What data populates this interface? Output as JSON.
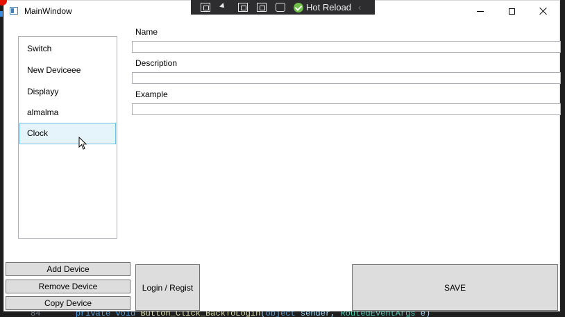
{
  "window": {
    "title": "MainWindow",
    "icon": "window-app-icon"
  },
  "caption_buttons": {
    "minimize": "minimize-icon",
    "maximize": "maximize-icon",
    "close": "close-icon"
  },
  "debug_toolbar": {
    "hot_reload_label": "Hot Reload",
    "icons": [
      "select-element-icon",
      "pointer-icon",
      "layout-adorner-icon",
      "track-focus-icon",
      "hot-reload-settings-icon"
    ]
  },
  "device_list": {
    "items": [
      {
        "label": "Switch",
        "selected": false
      },
      {
        "label": "New Deviceee",
        "selected": false
      },
      {
        "label": "Displayy",
        "selected": false
      },
      {
        "label": "almalma",
        "selected": false
      },
      {
        "label": "Clock",
        "selected": true
      }
    ]
  },
  "form": {
    "name_label": "Name",
    "name_value": "",
    "description_label": "Description",
    "description_value": "",
    "example_label": "Example",
    "example_value": ""
  },
  "buttons": {
    "add_device": "Add Device",
    "remove_device": "Remove Device",
    "copy_device": "Copy Device",
    "login_regist": "Login / Regist",
    "save": "SAVE"
  },
  "colors": {
    "selection_background": "#e5f3fb",
    "selection_border": "#70c0e7",
    "button_background": "#dddddd",
    "hot_reload_check": "#6fbf4a",
    "debug_toolbar_background": "#2d2d30",
    "breakpoint_red": "#e51400"
  }
}
